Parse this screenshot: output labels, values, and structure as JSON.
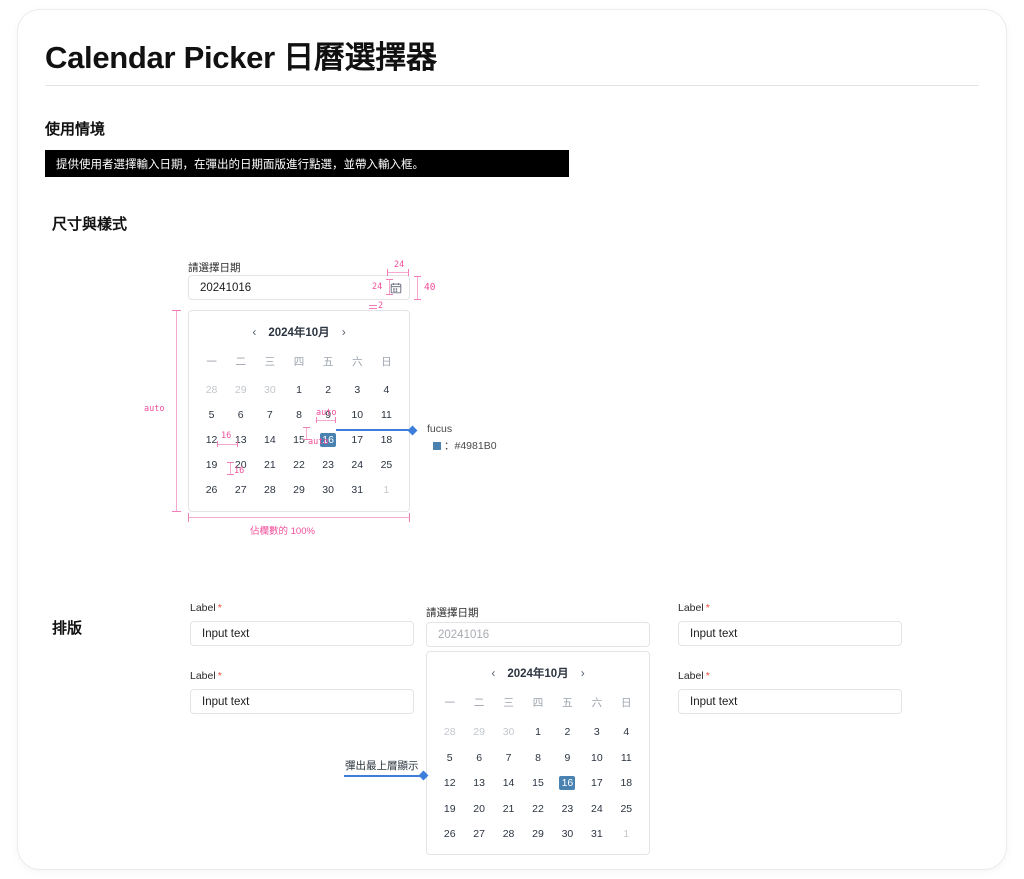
{
  "page": {
    "title": "Calendar Picker 日曆選擇器"
  },
  "sections": {
    "usage": {
      "heading": "使用情境",
      "description": "提供使用者選擇輸入日期，在彈出的日期面版進行點選，並帶入輸入框。"
    },
    "spec": {
      "heading": "尺寸與樣式"
    },
    "layout": {
      "heading": "排版"
    }
  },
  "date_field": {
    "label": "請選擇日期",
    "value": "20241016",
    "icon": "calendar-icon"
  },
  "calendar": {
    "prev_icon": "chevron-left-icon",
    "next_icon": "chevron-right-icon",
    "month_title": "2024年10月",
    "weekdays": [
      "一",
      "二",
      "三",
      "四",
      "五",
      "六",
      "日"
    ],
    "weeks": [
      [
        {
          "d": "28",
          "state": "muted"
        },
        {
          "d": "29",
          "state": "muted"
        },
        {
          "d": "30",
          "state": "muted"
        },
        {
          "d": "1",
          "state": "normal"
        },
        {
          "d": "2",
          "state": "normal"
        },
        {
          "d": "3",
          "state": "normal"
        },
        {
          "d": "4",
          "state": "normal"
        }
      ],
      [
        {
          "d": "5",
          "state": "normal"
        },
        {
          "d": "6",
          "state": "normal"
        },
        {
          "d": "7",
          "state": "normal"
        },
        {
          "d": "8",
          "state": "normal"
        },
        {
          "d": "9",
          "state": "normal"
        },
        {
          "d": "10",
          "state": "normal"
        },
        {
          "d": "11",
          "state": "normal"
        }
      ],
      [
        {
          "d": "12",
          "state": "normal"
        },
        {
          "d": "13",
          "state": "normal"
        },
        {
          "d": "14",
          "state": "normal"
        },
        {
          "d": "15",
          "state": "normal"
        },
        {
          "d": "16",
          "state": "selected"
        },
        {
          "d": "17",
          "state": "normal"
        },
        {
          "d": "18",
          "state": "normal"
        }
      ],
      [
        {
          "d": "19",
          "state": "normal"
        },
        {
          "d": "20",
          "state": "normal"
        },
        {
          "d": "21",
          "state": "normal"
        },
        {
          "d": "22",
          "state": "normal"
        },
        {
          "d": "23",
          "state": "normal"
        },
        {
          "d": "24",
          "state": "normal"
        },
        {
          "d": "25",
          "state": "normal"
        }
      ],
      [
        {
          "d": "26",
          "state": "normal"
        },
        {
          "d": "27",
          "state": "normal"
        },
        {
          "d": "28",
          "state": "normal"
        },
        {
          "d": "29",
          "state": "normal"
        },
        {
          "d": "30",
          "state": "normal"
        },
        {
          "d": "31",
          "state": "normal"
        },
        {
          "d": "1",
          "state": "muted"
        }
      ]
    ]
  },
  "annotations": {
    "icon_gap": "24",
    "icon_size": "24",
    "input_height": "40",
    "panel_offset": "2",
    "panel_height": "auto",
    "cell_gap_h": "16",
    "cell_gap_v": "16",
    "cell_auto_top": "auto",
    "cell_auto_bottom": "auto",
    "panel_width": "佔欄數的 100%",
    "focus_label": "fucus",
    "focus_color": "#4981B0",
    "popup_label": "彈出最上層顯示"
  },
  "layout_fields": {
    "left": [
      {
        "label": "Label",
        "required": "*",
        "value": "Input  text"
      },
      {
        "label": "Label",
        "required": "*",
        "value": "Input  text"
      }
    ],
    "right": [
      {
        "label": "Label",
        "required": "*",
        "value": "Input  text"
      },
      {
        "label": "Label",
        "required": "*",
        "value": "Input  text"
      }
    ]
  },
  "colors": {
    "accent_blue": "#4981B0",
    "callout_blue": "#3d7ddb",
    "spec_pink": "#ef4e9a",
    "required_red": "#e8503a"
  }
}
